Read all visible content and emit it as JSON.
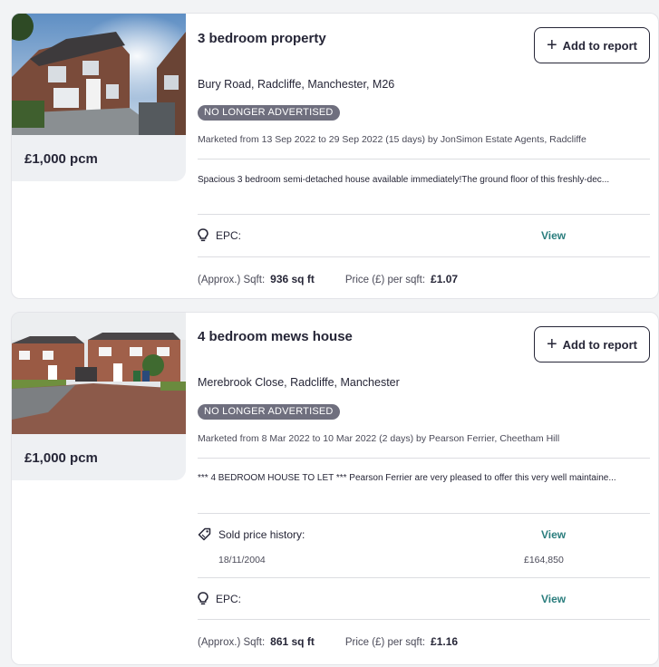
{
  "listings": [
    {
      "title": "3 bedroom property",
      "price": "£1,000 pcm",
      "add_label": "Add to report",
      "address": "Bury Road, Radcliffe, Manchester, M26",
      "status": "NO LONGER ADVERTISED",
      "marketed": "Marketed from 13 Sep 2022 to 29 Sep 2022 (15 days) by JonSimon Estate Agents, Radcliffe",
      "description": "Spacious 3 bedroom semi-detached house available immediately!The ground floor of this freshly-dec...",
      "epc_label": "EPC:",
      "epc_view": "View",
      "sqft_label": "(Approx.) Sqft:",
      "sqft_value": "936 sq ft",
      "ppsf_label": "Price (£) per sqft:",
      "ppsf_value": "£1.07"
    },
    {
      "title": "4 bedroom mews house",
      "price": "£1,000 pcm",
      "add_label": "Add to report",
      "address": "Merebrook Close, Radcliffe, Manchester",
      "status": "NO LONGER ADVERTISED",
      "marketed": "Marketed from 8 Mar 2022 to 10 Mar 2022 (2 days) by Pearson Ferrier, Cheetham Hill",
      "description": "*** 4 BEDROOM HOUSE TO LET *** Pearson Ferrier are very pleased to offer this very well maintaine...",
      "history_label": "Sold price history:",
      "history_view": "View",
      "history_date": "18/11/2004",
      "history_price": "£164,850",
      "epc_label": "EPC:",
      "epc_view": "View",
      "sqft_label": "(Approx.) Sqft:",
      "sqft_value": "861 sq ft",
      "ppsf_label": "Price (£) per sqft:",
      "ppsf_value": "£1.16"
    }
  ],
  "icons": {
    "plus": "plus-icon",
    "bulb": "lightbulb-icon",
    "tag": "price-tag-icon"
  },
  "colors": {
    "link": "#2a7d7d",
    "badge": "#6f6f7e",
    "text": "#262637"
  }
}
